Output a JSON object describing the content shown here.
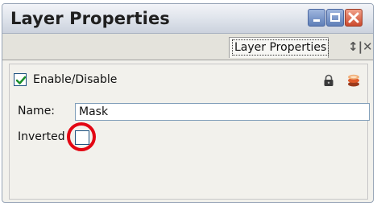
{
  "window": {
    "title": "Layer Properties"
  },
  "tabs": [
    {
      "label": "Layer Properties",
      "active": true
    }
  ],
  "tab_controls": {
    "label": "↕|✕"
  },
  "form": {
    "enable": {
      "label": "Enable/Disable",
      "checked": true
    },
    "name": {
      "label": "Name:",
      "value": "Mask"
    },
    "inverted": {
      "label": "Inverted",
      "checked": false
    }
  },
  "icons": {
    "lock": "lock-icon",
    "layers": "layers-icon",
    "checkmark": "checkmark-icon",
    "minimize": "minimize-icon",
    "maximize": "maximize-icon",
    "close": "close-icon"
  },
  "colors": {
    "highlight_ring": "#e30613",
    "checkmark": "#1a8f2a",
    "close_button": "#cc4a2e",
    "window_button": "#5f7fb8"
  }
}
